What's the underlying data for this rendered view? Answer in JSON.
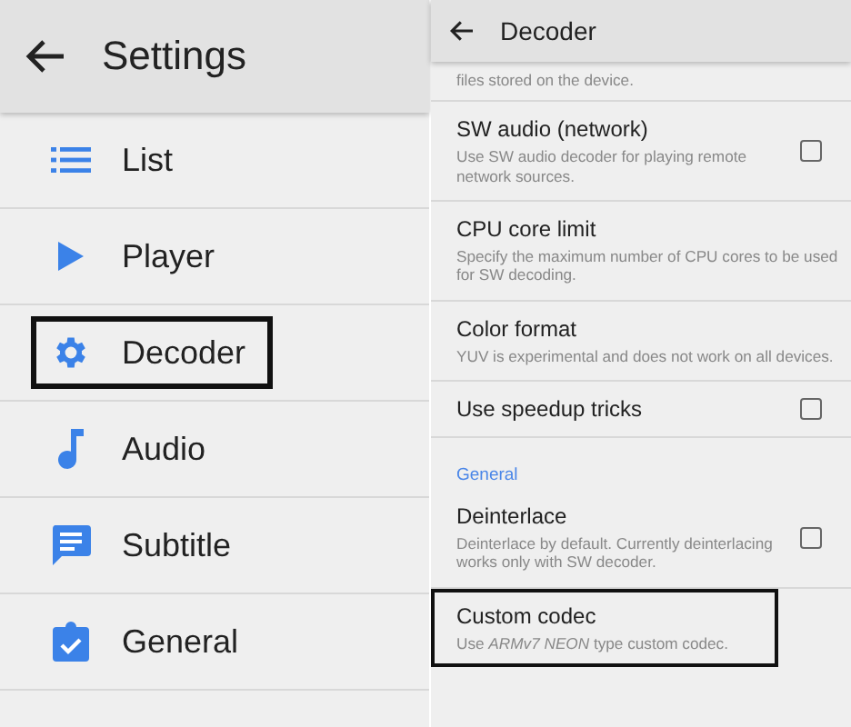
{
  "settings": {
    "title": "Settings",
    "items": [
      {
        "label": "List",
        "kind": "list",
        "highlighted": false
      },
      {
        "label": "Player",
        "kind": "play",
        "highlighted": false
      },
      {
        "label": "Decoder",
        "kind": "gear",
        "highlighted": true
      },
      {
        "label": "Audio",
        "kind": "note",
        "highlighted": false
      },
      {
        "label": "Subtitle",
        "kind": "chat",
        "highlighted": false
      },
      {
        "label": "General",
        "kind": "clipboard",
        "highlighted": false
      }
    ]
  },
  "decoder": {
    "title": "Decoder",
    "items": [
      {
        "kind": "partial",
        "summary": "files stored on the device."
      },
      {
        "kind": "checkbox",
        "title": "SW audio (network)",
        "summary": "Use SW audio decoder for playing remote network sources.",
        "checked": false,
        "highlighted": false
      },
      {
        "kind": "plain",
        "title": "CPU core limit",
        "summary": "Specify the maximum number of CPU cores to be used for SW decoding.",
        "highlighted": false
      },
      {
        "kind": "plain",
        "title": "Color format",
        "summary": "YUV is experimental and does not work on all devices.",
        "highlighted": false
      },
      {
        "kind": "checkbox",
        "title": "Use speedup tricks",
        "checked": false,
        "highlighted": false
      },
      {
        "kind": "header",
        "title": "General"
      },
      {
        "kind": "checkbox",
        "title": "Deinterlace",
        "summary": "Deinterlace by default. Currently deinterlacing works only with SW decoder.",
        "checked": false,
        "highlighted": false
      },
      {
        "kind": "plain",
        "title": "Custom codec",
        "summary": "Use *ARMv7 NEON* type custom codec.",
        "highlighted": true
      }
    ]
  }
}
